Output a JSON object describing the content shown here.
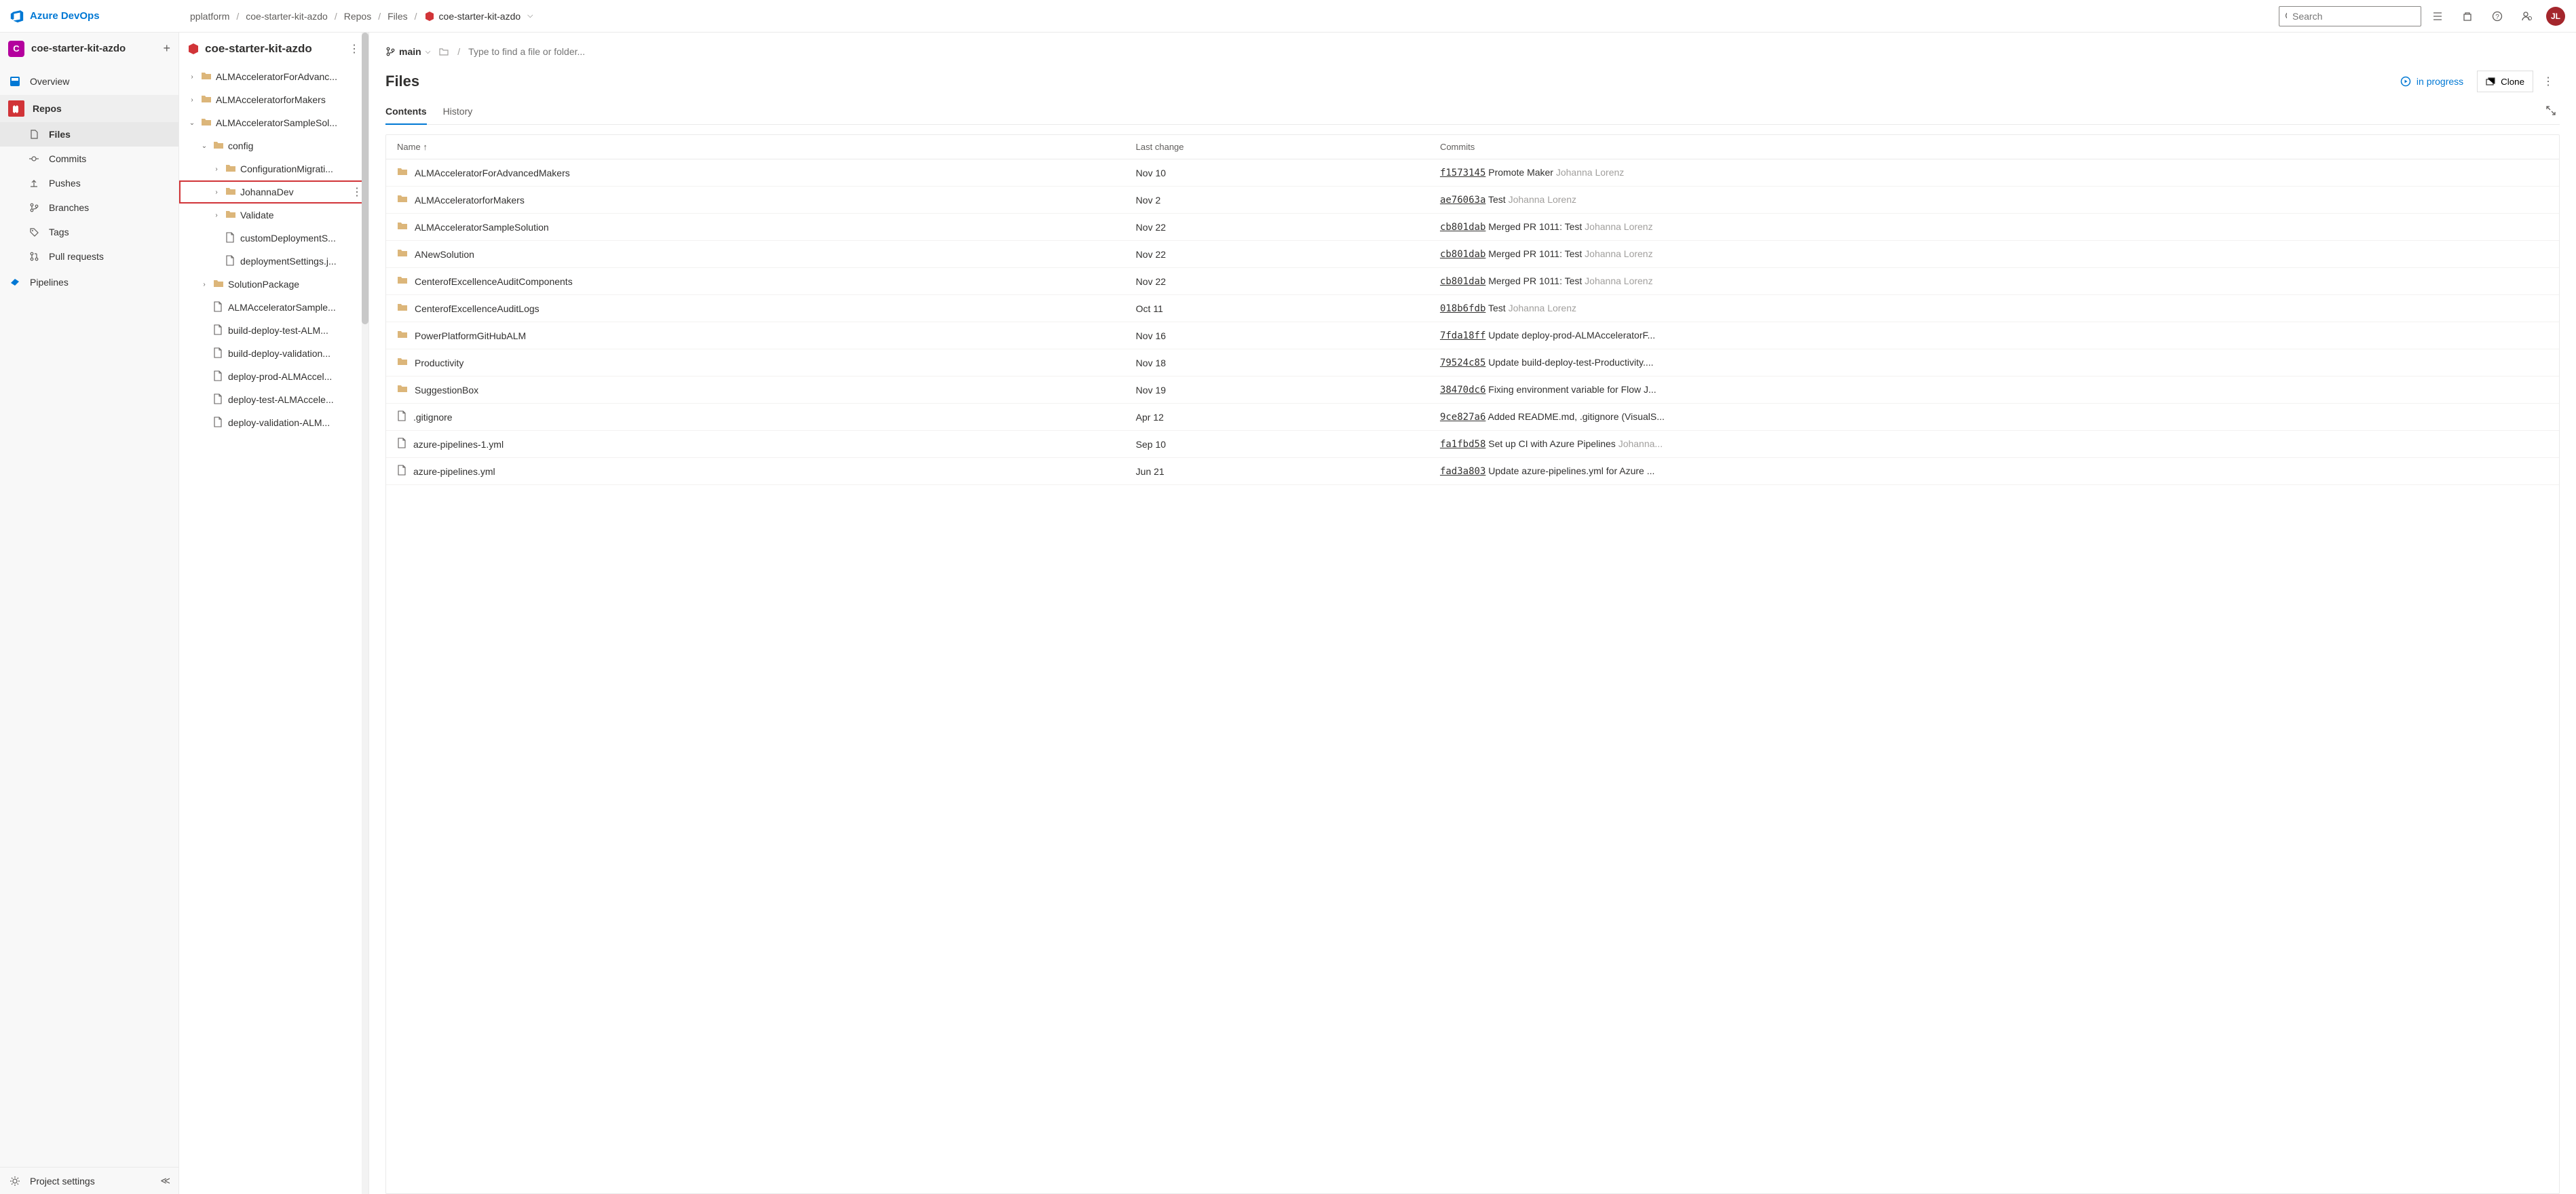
{
  "brand": {
    "name": "Azure DevOps"
  },
  "breadcrumb": {
    "org": "pplatform",
    "project": "coe-starter-kit-azdo",
    "area": "Repos",
    "sub": "Files",
    "repo": "coe-starter-kit-azdo"
  },
  "search": {
    "placeholder": "Search"
  },
  "avatar": {
    "initials": "JL"
  },
  "project": {
    "badge": "C",
    "name": "coe-starter-kit-azdo"
  },
  "nav": {
    "overview": "Overview",
    "repos": "Repos",
    "files": "Files",
    "commits": "Commits",
    "pushes": "Pushes",
    "branches": "Branches",
    "tags": "Tags",
    "pull_requests": "Pull requests",
    "pipelines": "Pipelines",
    "project_settings": "Project settings"
  },
  "tree": {
    "repo_title": "coe-starter-kit-azdo",
    "items": [
      {
        "depth": 0,
        "caret": "right",
        "type": "folder",
        "label": "ALMAcceleratorForAdvanc..."
      },
      {
        "depth": 0,
        "caret": "right",
        "type": "folder",
        "label": "ALMAcceleratorforMakers"
      },
      {
        "depth": 0,
        "caret": "down",
        "type": "folder",
        "label": "ALMAcceleratorSampleSol..."
      },
      {
        "depth": 1,
        "caret": "down",
        "type": "folder",
        "label": "config"
      },
      {
        "depth": 2,
        "caret": "right",
        "type": "folder",
        "label": "ConfigurationMigrati..."
      },
      {
        "depth": 2,
        "caret": "right",
        "type": "folder",
        "label": "JohannaDev",
        "highlight": true,
        "more": true
      },
      {
        "depth": 2,
        "caret": "right",
        "type": "folder",
        "label": "Validate"
      },
      {
        "depth": 2,
        "caret": "",
        "type": "file",
        "label": "customDeploymentS..."
      },
      {
        "depth": 2,
        "caret": "",
        "type": "file",
        "label": "deploymentSettings.j..."
      },
      {
        "depth": 1,
        "caret": "right",
        "type": "folder",
        "label": "SolutionPackage"
      },
      {
        "depth": 1,
        "caret": "",
        "type": "file",
        "label": "ALMAcceleratorSample..."
      },
      {
        "depth": 1,
        "caret": "",
        "type": "file",
        "label": "build-deploy-test-ALM..."
      },
      {
        "depth": 1,
        "caret": "",
        "type": "file",
        "label": "build-deploy-validation..."
      },
      {
        "depth": 1,
        "caret": "",
        "type": "file",
        "label": "deploy-prod-ALMAccel..."
      },
      {
        "depth": 1,
        "caret": "",
        "type": "file",
        "label": "deploy-test-ALMAccele..."
      },
      {
        "depth": 1,
        "caret": "",
        "type": "file",
        "label": "deploy-validation-ALM..."
      }
    ]
  },
  "branch": {
    "name": "main"
  },
  "path_placeholder": "Type to find a file or folder...",
  "page_title": "Files",
  "in_progress": "in progress",
  "clone": "Clone",
  "tabs": {
    "contents": "Contents",
    "history": "History"
  },
  "table": {
    "headers": {
      "name": "Name",
      "last_change": "Last change",
      "commits": "Commits"
    },
    "rows": [
      {
        "type": "folder",
        "name": "ALMAcceleratorForAdvancedMakers",
        "date": "Nov 10",
        "hash": "f1573145",
        "msg": "Promote Maker",
        "author": "Johanna Lorenz"
      },
      {
        "type": "folder",
        "name": "ALMAcceleratorforMakers",
        "date": "Nov 2",
        "hash": "ae76063a",
        "msg": "Test",
        "author": "Johanna Lorenz"
      },
      {
        "type": "folder",
        "name": "ALMAcceleratorSampleSolution",
        "date": "Nov 22",
        "hash": "cb801dab",
        "msg": "Merged PR 1011: Test",
        "author": "Johanna Lorenz"
      },
      {
        "type": "folder",
        "name": "ANewSolution",
        "date": "Nov 22",
        "hash": "cb801dab",
        "msg": "Merged PR 1011: Test",
        "author": "Johanna Lorenz"
      },
      {
        "type": "folder",
        "name": "CenterofExcellenceAuditComponents",
        "date": "Nov 22",
        "hash": "cb801dab",
        "msg": "Merged PR 1011: Test",
        "author": "Johanna Lorenz"
      },
      {
        "type": "folder",
        "name": "CenterofExcellenceAuditLogs",
        "date": "Oct 11",
        "hash": "018b6fdb",
        "msg": "Test",
        "author": "Johanna Lorenz"
      },
      {
        "type": "folder",
        "name": "PowerPlatformGitHubALM",
        "date": "Nov 16",
        "hash": "7fda18ff",
        "msg": "Update deploy-prod-ALMAcceleratorF...",
        "author": ""
      },
      {
        "type": "folder",
        "name": "Productivity",
        "date": "Nov 18",
        "hash": "79524c85",
        "msg": "Update build-deploy-test-Productivity....",
        "author": ""
      },
      {
        "type": "folder",
        "name": "SuggestionBox",
        "date": "Nov 19",
        "hash": "38470dc6",
        "msg": "Fixing environment variable for Flow J...",
        "author": ""
      },
      {
        "type": "file",
        "name": ".gitignore",
        "date": "Apr 12",
        "hash": "9ce827a6",
        "msg": "Added README.md, .gitignore (VisualS...",
        "author": ""
      },
      {
        "type": "file",
        "name": "azure-pipelines-1.yml",
        "date": "Sep 10",
        "hash": "fa1fbd58",
        "msg": "Set up CI with Azure Pipelines",
        "author": "Johanna..."
      },
      {
        "type": "file",
        "name": "azure-pipelines.yml",
        "date": "Jun 21",
        "hash": "fad3a803",
        "msg": "Update azure-pipelines.yml for Azure ...",
        "author": ""
      }
    ]
  }
}
